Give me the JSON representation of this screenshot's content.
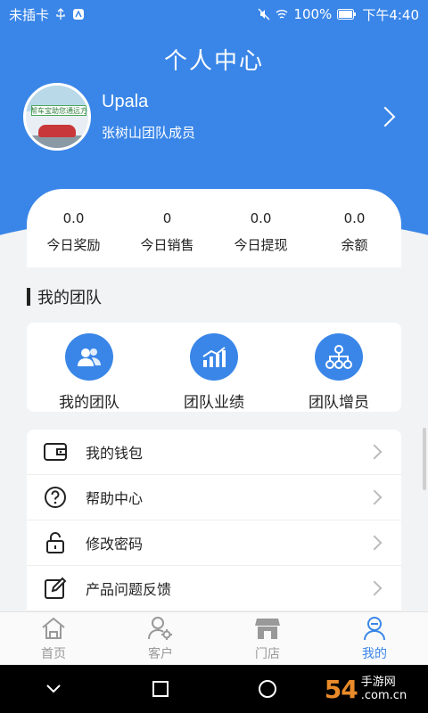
{
  "status_bar": {
    "carrier": "未插卡",
    "battery": "100%",
    "time": "下午4:40"
  },
  "page_title": "个人中心",
  "profile": {
    "username": "Upala",
    "role": "张树山团队成员",
    "avatar_banner_text": "帮车宝助您通远方"
  },
  "stats": [
    {
      "value": "0.0",
      "label": "今日奖励"
    },
    {
      "value": "0",
      "label": "今日销售"
    },
    {
      "value": "0.0",
      "label": "今日提现"
    },
    {
      "value": "0.0",
      "label": "余额"
    }
  ],
  "team_section": {
    "title": "我的团队",
    "items": [
      {
        "label": "我的团队",
        "icon": "team-members-icon"
      },
      {
        "label": "团队业绩",
        "icon": "bar-chart-icon"
      },
      {
        "label": "团队增员",
        "icon": "org-tree-icon"
      }
    ]
  },
  "menu": [
    {
      "label": "我的钱包",
      "icon": "wallet-icon"
    },
    {
      "label": "帮助中心",
      "icon": "help-icon"
    },
    {
      "label": "修改密码",
      "icon": "lock-icon"
    },
    {
      "label": "产品问题反馈",
      "icon": "edit-icon"
    }
  ],
  "tabs": [
    {
      "label": "首页",
      "icon": "home-icon",
      "active": false
    },
    {
      "label": "客户",
      "icon": "customer-icon",
      "active": false
    },
    {
      "label": "门店",
      "icon": "store-icon",
      "active": false
    },
    {
      "label": "我的",
      "icon": "profile-icon",
      "active": true
    }
  ],
  "watermark": {
    "number": "54",
    "brand_line1": "手游网",
    "brand_line2": ".com.cn"
  },
  "colors": {
    "primary": "#3a86e8",
    "background": "#f2f3f5",
    "tab_inactive": "#999999"
  }
}
